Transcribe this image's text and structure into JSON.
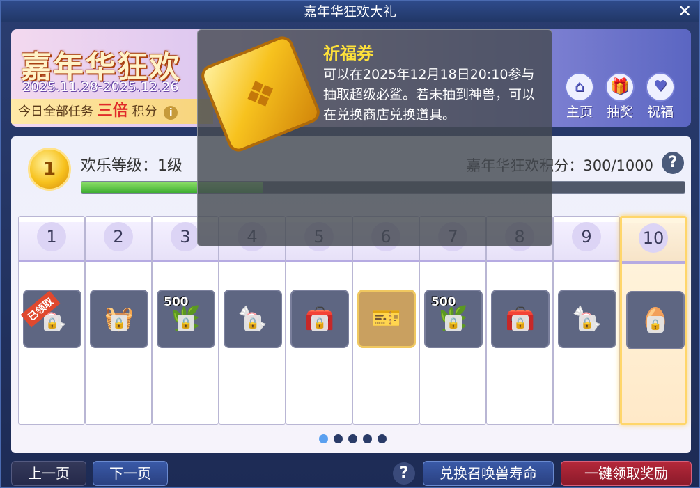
{
  "window": {
    "title": "嘉年华狂欢大礼",
    "close_glyph": "✕"
  },
  "banner": {
    "title": "嘉年华狂欢",
    "date_range": "2025.11.28-2025.12.26",
    "strip_prefix": "今日全部任务",
    "strip_highlight": "三倍",
    "strip_suffix": "积分",
    "info_glyph": "i",
    "nav": [
      {
        "label": "主页",
        "icon": "home-icon",
        "glyph": "⌂"
      },
      {
        "label": "抽奖",
        "icon": "gift-icon",
        "glyph": "🎁"
      },
      {
        "label": "祝福",
        "icon": "heart-icon",
        "glyph": "♥"
      }
    ]
  },
  "progress": {
    "level_number": "1",
    "level_label": "欢乐等级：1级",
    "points_label": "嘉年华狂欢积分：300/1000",
    "points_current": 300,
    "points_max": 1000,
    "help_glyph": "?"
  },
  "levels": [
    {
      "number": "1",
      "item": "candy-icon",
      "glyph": "🍬",
      "claimed_tag": "已领取"
    },
    {
      "number": "2",
      "item": "food-basket-icon",
      "glyph": "🧺"
    },
    {
      "number": "3",
      "item": "leaf-bundle-icon",
      "glyph": "🌿",
      "qty": "500"
    },
    {
      "number": "4",
      "item": "candy-icon",
      "glyph": "🍬"
    },
    {
      "number": "5",
      "item": "chest-icon",
      "glyph": "🧰"
    },
    {
      "number": "6",
      "item": "blessing-ticket-icon",
      "glyph": "🎫"
    },
    {
      "number": "7",
      "item": "leaf-bundle-icon",
      "glyph": "🌿",
      "qty": "500"
    },
    {
      "number": "8",
      "item": "chest-icon",
      "glyph": "🧰"
    },
    {
      "number": "9",
      "item": "candy-icon",
      "glyph": "🍬"
    },
    {
      "number": "10",
      "item": "egg-icon",
      "glyph": "🥚"
    }
  ],
  "pagination": {
    "total": 5,
    "active": 0
  },
  "buttons": {
    "prev": "上一页",
    "next": "下一页",
    "help": "?",
    "exchange": "兑换召唤兽寿命",
    "claim_all": "一键领取奖励"
  },
  "tooltip": {
    "title": "祈福券",
    "body": "可以在2025年12月18日20:10参与抽取超级必鲨。若未抽到神兽，可以在兑换商店兑换道具。",
    "icon": "ticket-icon"
  },
  "colors": {
    "accent_gold": "#f7c21e",
    "tooltip_title": "#ffe23a",
    "progress_green": "#3fae32",
    "claim_red": "#b5283a"
  }
}
